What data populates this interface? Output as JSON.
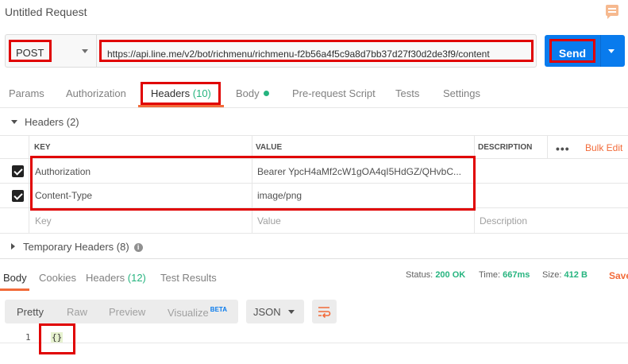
{
  "title": "Untitled Request",
  "request": {
    "method": "POST",
    "url": "https://api.line.me/v2/bot/richmenu/richmenu-f2b56a4f5c9a8d7bb37d27f30d2de3f9/content",
    "send_label": "Send"
  },
  "request_tabs": [
    {
      "label": "Params"
    },
    {
      "label": "Authorization"
    },
    {
      "label": "Headers",
      "count": "(10)"
    },
    {
      "label": "Body"
    },
    {
      "label": "Pre-request Script"
    },
    {
      "label": "Tests"
    },
    {
      "label": "Settings"
    }
  ],
  "headers_section": {
    "title": "Headers (2)",
    "columns": {
      "key": "KEY",
      "value": "VALUE",
      "description": "DESCRIPTION"
    },
    "bulk_edit": "Bulk Edit",
    "more": "•••",
    "rows": [
      {
        "key": "Authorization",
        "value": "Bearer YpcH4aMf2cW1gOA4qI5HdGZ/QHvbC...",
        "checked": true
      },
      {
        "key": "Content-Type",
        "value": "image/png",
        "checked": true
      }
    ],
    "placeholders": {
      "key": "Key",
      "value": "Value",
      "description": "Description"
    }
  },
  "temporary_headers": {
    "title": "Temporary Headers (8)"
  },
  "response": {
    "tabs": [
      {
        "label": "Body"
      },
      {
        "label": "Cookies"
      },
      {
        "label": "Headers",
        "count": "(12)"
      },
      {
        "label": "Test Results"
      }
    ],
    "status_label": "Status:",
    "status_value": "200 OK",
    "time_label": "Time:",
    "time_value": "667ms",
    "size_label": "Size:",
    "size_value": "412 B",
    "save": "Save",
    "view_modes": [
      "Pretty",
      "Raw",
      "Preview",
      "Visualize"
    ],
    "beta": "BETA",
    "format": "JSON",
    "line_number": "1",
    "body": "{}"
  },
  "colors": {
    "accent": "#f26b3a",
    "primary": "#097bed",
    "success": "#26b47f",
    "highlight": "#e00000"
  }
}
